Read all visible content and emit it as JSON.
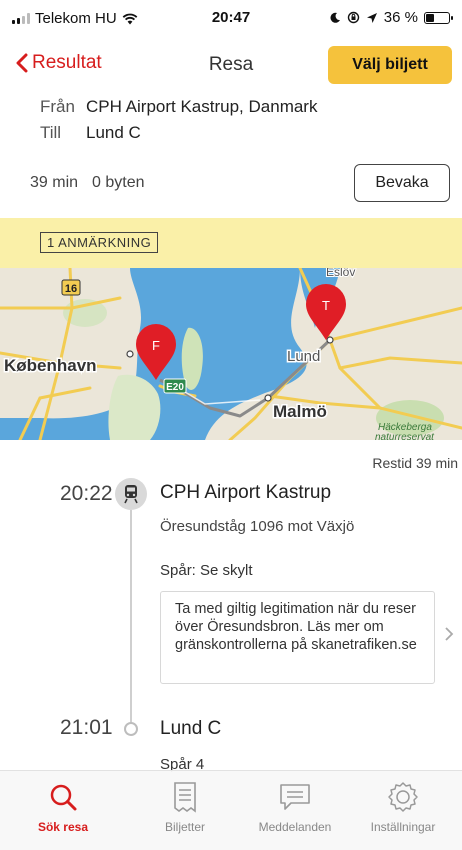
{
  "status_bar": {
    "carrier": "Telekom HU",
    "time": "20:47",
    "battery": "36 %",
    "battery_level": 0.36
  },
  "nav": {
    "back_label": "Resultat",
    "title": "Resa",
    "buy_button": "Välj biljett"
  },
  "route": {
    "from_label": "Från",
    "from_value": "CPH Airport Kastrup, Danmark",
    "to_label": "Till",
    "to_value": "Lund C"
  },
  "summary": {
    "duration": "39 min",
    "changes": "0 byten",
    "watch_button": "Bevaka"
  },
  "notice": {
    "badge": "1 ANMÄRKNING"
  },
  "map": {
    "labels": {
      "kobenhavn": "København",
      "lund": "Lund",
      "malmo": "Malmö",
      "eslov": "Eslöv",
      "hackeberga_1": "Häckeberga",
      "hackeberga_2": "naturreservat",
      "road_16": "16",
      "road_e20": "E20"
    },
    "pin_from": "F",
    "pin_to": "T"
  },
  "journey": {
    "travel_time": "Restid 39 min",
    "departure": {
      "time": "20:22",
      "station": "CPH Airport Kastrup",
      "train": "Öresundståg 1096 mot Växjö",
      "track": "Spår: Se skylt"
    },
    "info_box": "Ta med giltig legitimation när du reser över Öresundsbron. Läs mer om gränskontrollerna på skanetrafiken.se",
    "arrival": {
      "time": "21:01",
      "station": "Lund C",
      "track": "Spår 4"
    }
  },
  "tabs": [
    {
      "label": "Sök resa",
      "icon": "search-icon",
      "active": true
    },
    {
      "label": "Biljetter",
      "icon": "ticket-icon",
      "active": false
    },
    {
      "label": "Meddelanden",
      "icon": "message-icon",
      "active": false
    },
    {
      "label": "Inställningar",
      "icon": "gear-icon",
      "active": false
    }
  ],
  "colors": {
    "accent": "#d71d1d",
    "button": "#f5c23c",
    "notice_bg": "#faf0a8",
    "water": "#5aa6dc",
    "land": "#e9e4d7",
    "road": "#f2cc52"
  }
}
